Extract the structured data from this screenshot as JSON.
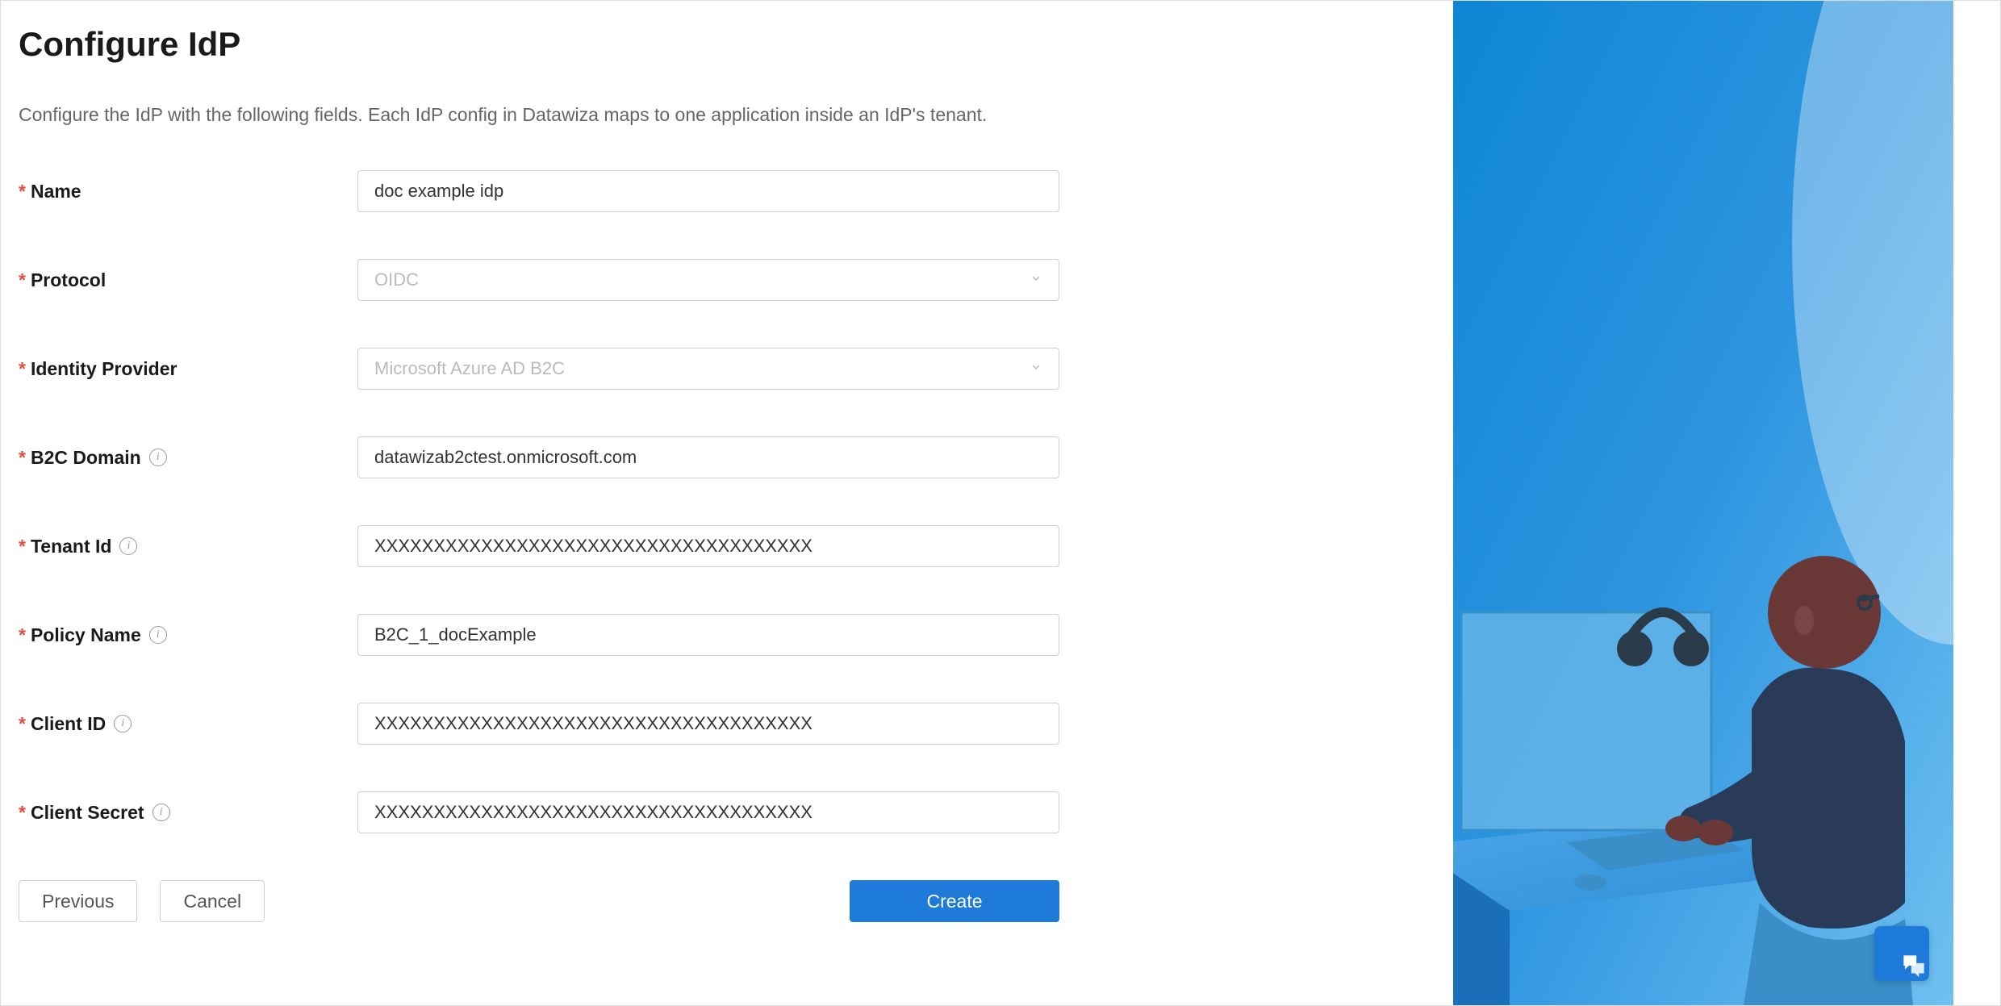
{
  "page": {
    "title": "Configure IdP",
    "description": "Configure the IdP with the following fields. Each IdP config in Datawiza maps to one application inside an IdP's tenant."
  },
  "form": {
    "fields": {
      "name": {
        "label": "Name",
        "value": "doc example idp"
      },
      "protocol": {
        "label": "Protocol",
        "value": "OIDC"
      },
      "identity_provider": {
        "label": "Identity Provider",
        "value": "Microsoft Azure AD B2C"
      },
      "b2c_domain": {
        "label": "B2C Domain",
        "value": "datawizab2ctest.onmicrosoft.com"
      },
      "tenant_id": {
        "label": "Tenant Id",
        "value": "XXXXXXXXXXXXXXXXXXXXXXXXXXXXXXXXXXXXX"
      },
      "policy_name": {
        "label": "Policy Name",
        "value": "B2C_1_docExample"
      },
      "client_id": {
        "label": "Client ID",
        "value": "XXXXXXXXXXXXXXXXXXXXXXXXXXXXXXXXXXXXX"
      },
      "client_secret": {
        "label": "Client Secret",
        "value": "XXXXXXXXXXXXXXXXXXXXXXXXXXXXXXXXXXXXX"
      }
    }
  },
  "buttons": {
    "previous": "Previous",
    "cancel": "Cancel",
    "create": "Create"
  }
}
